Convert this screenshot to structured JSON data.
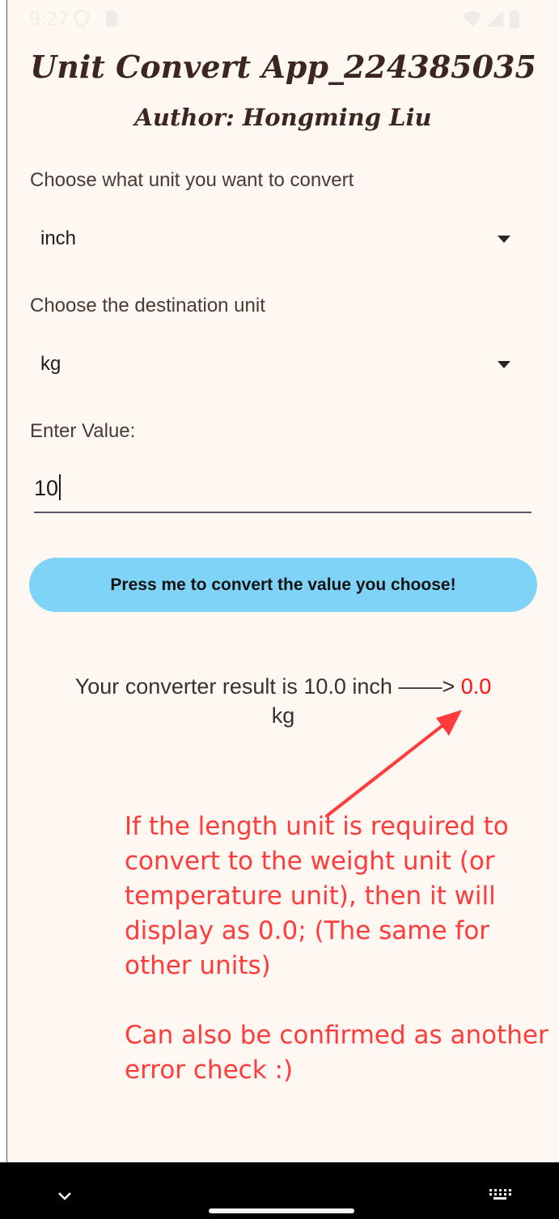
{
  "status_bar": {
    "time": "9:27"
  },
  "app": {
    "title": "Unit Convert App_224385035",
    "author": "Author: Hongming Liu"
  },
  "source_unit": {
    "label": "Choose what unit you want to convert",
    "value": "inch"
  },
  "destination_unit": {
    "label": "Choose the destination unit",
    "value": "kg"
  },
  "value_input": {
    "label": "Enter Value:",
    "value": "10"
  },
  "convert_button": {
    "label": "Press me to convert the value you choose!"
  },
  "result": {
    "prefix": "Your converter result is 10.0 inch ——> ",
    "value": "0.0",
    "unit": "kg"
  },
  "annotation": {
    "line1": "If the length unit is required to convert to the weight unit (or temperature unit), then it will display as 0.0; (The same for other units)",
    "line2": "Can also be confirmed as another error check :)"
  },
  "colors": {
    "background": "#fff7f1",
    "button": "#7fd3f6",
    "title_text": "#3d2621",
    "annotation": "#ff3b3b",
    "result_value": "#ff1010"
  },
  "icons": {
    "status": [
      "shield-icon",
      "sim-card-icon",
      "wifi-icon",
      "signal-icon",
      "battery-icon"
    ],
    "nav": [
      "chevron-down-icon",
      "keyboard-icon"
    ]
  }
}
